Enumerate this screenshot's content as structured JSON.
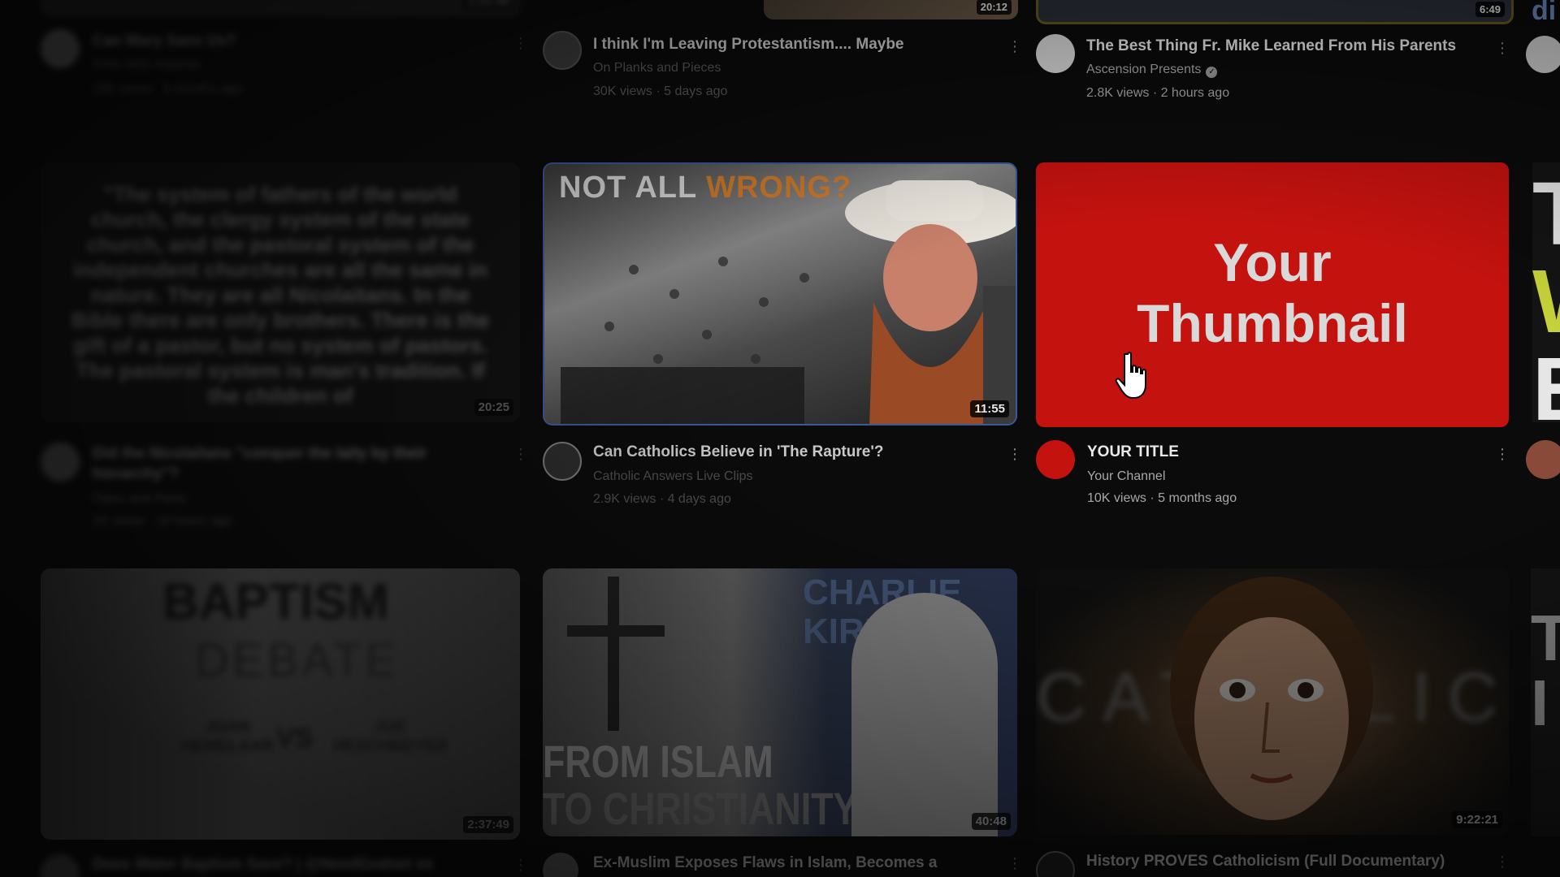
{
  "row1": [
    {
      "title": "Can Mary Save Us?",
      "channel": "Pints With Aquinas",
      "meta": "26K views · 8 months ago",
      "duration": "1:22:49"
    },
    {
      "title": "I think I'm Leaving Protestantism.... Maybe",
      "channel": "On Planks and Pieces",
      "meta": "30K views · 5 days ago",
      "duration": "20:12"
    },
    {
      "title": "The Best Thing Fr. Mike Learned From His Parents",
      "channel": "Ascension Presents",
      "meta": "2.8K views · 2 hours ago",
      "duration": "6:49",
      "verified_icon": "verified-check-icon"
    }
  ],
  "row2": [
    {
      "thumb_quote": "\"The system of fathers of the world church, the clergy system of the state church, and the pastoral system of the independent churches are all the same in nature. They are all Nicolaitans. In the Bible there are only brothers. There is the gift of a pastor, but no system of pastors. The pastoral system is man's tradition. If the children of",
      "duration": "20:25",
      "title": "Did the Nicolaitans \"conquer the laity by their hierarchy\"?",
      "channel": "Pipes and Pews",
      "meta": "1K views · 10 hours ago"
    },
    {
      "thumb_word_white": "NOT ALL",
      "thumb_word_orange": "WRONG?",
      "duration": "11:55",
      "title": "Can Catholics Believe in 'The Rapture'?",
      "channel": "Catholic Answers Live Clips",
      "meta": "2.9K views · 4 days ago"
    },
    {
      "thumb_line1": "Your",
      "thumb_line2": "Thumbnail",
      "title": "YOUR TITLE",
      "channel": "Your Channel",
      "meta": "10K views · 5 months ago",
      "accent": "#c4120f"
    }
  ],
  "row3": [
    {
      "thumb_top": "BAPTISM",
      "thumb_mid": "DEBATE",
      "thumb_left_name": "JOAN HEMELAAR",
      "thumb_vs": "VS",
      "thumb_right_name": "JOE HESCHMEYER",
      "duration": "2:37:49",
      "title": "Does Water Baptism Save? | @NeedGodnet vs",
      "channel": "",
      "meta": ""
    },
    {
      "thumb_top": "CHARLIE KIRK",
      "thumb_line1": "FROM ISLAM",
      "thumb_line2": "TO CHRISTIANITY",
      "duration": "40:48",
      "title": "Ex-Muslim Exposes Flaws in Islam, Becomes a",
      "channel": "",
      "meta": ""
    },
    {
      "thumb_word": "CATHOLIC",
      "duration": "9:22:21",
      "title": "History PROVES Catholicism (Full Documentary)",
      "channel": "",
      "meta": ""
    }
  ],
  "edge_partial": {
    "top_text": "di",
    "thumb_letters": [
      "T",
      "W",
      "E"
    ],
    "thumb_letters_row3": [
      "T",
      "I"
    ]
  },
  "colors": {
    "background": "#0b0b0b",
    "red_thumb": "#c4120f",
    "orange_word": "#e07a1f",
    "yellow_letter": "#c6d23a"
  }
}
